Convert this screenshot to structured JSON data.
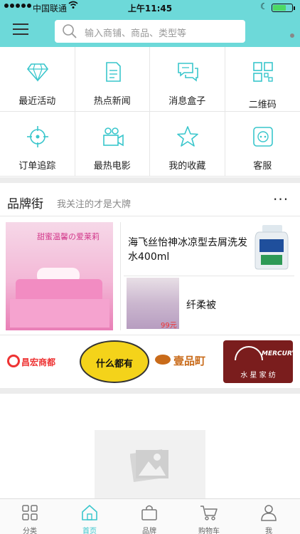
{
  "status_bar": {
    "carrier": "中国联通",
    "time": "上午11:45"
  },
  "search": {
    "placeholder": "输入商铺、商品、类型等"
  },
  "grid": [
    {
      "label": "最近活动",
      "icon": "diamond-icon"
    },
    {
      "label": "热点新闻",
      "icon": "document-icon"
    },
    {
      "label": "消息盒子",
      "icon": "chat-icon"
    },
    {
      "label": "二维码",
      "icon": "qr-code-icon"
    },
    {
      "label": "订单追踪",
      "icon": "target-icon"
    },
    {
      "label": "最热电影",
      "icon": "video-camera-icon"
    },
    {
      "label": "我的收藏",
      "icon": "star-icon"
    },
    {
      "label": "客服",
      "icon": "socket-icon"
    }
  ],
  "brand": {
    "title": "品牌街",
    "subtitle": "我关注的才是大牌",
    "more": "···",
    "promo_left_text": "甜蜜温馨の爱莱莉",
    "product1": "海飞丝怡神冰凉型去屑洗发水400ml",
    "product2": "纤柔被",
    "product2_price": "99元"
  },
  "logos": {
    "l1": "昌宏商都",
    "l2": "什么都有",
    "l3": "壹品町",
    "l4_en": "MERCURY",
    "l4_cn": "水 星 家 纺"
  },
  "tabs": [
    {
      "label": "分类",
      "icon": "grid-icon"
    },
    {
      "label": "首页",
      "icon": "home-icon"
    },
    {
      "label": "品牌",
      "icon": "bag-icon"
    },
    {
      "label": "购物车",
      "icon": "cart-icon"
    },
    {
      "label": "我",
      "icon": "user-icon"
    }
  ],
  "colors": {
    "accent": "#6dd9d9",
    "icon": "#39c6cc",
    "active_tab": "#39c6cc"
  }
}
